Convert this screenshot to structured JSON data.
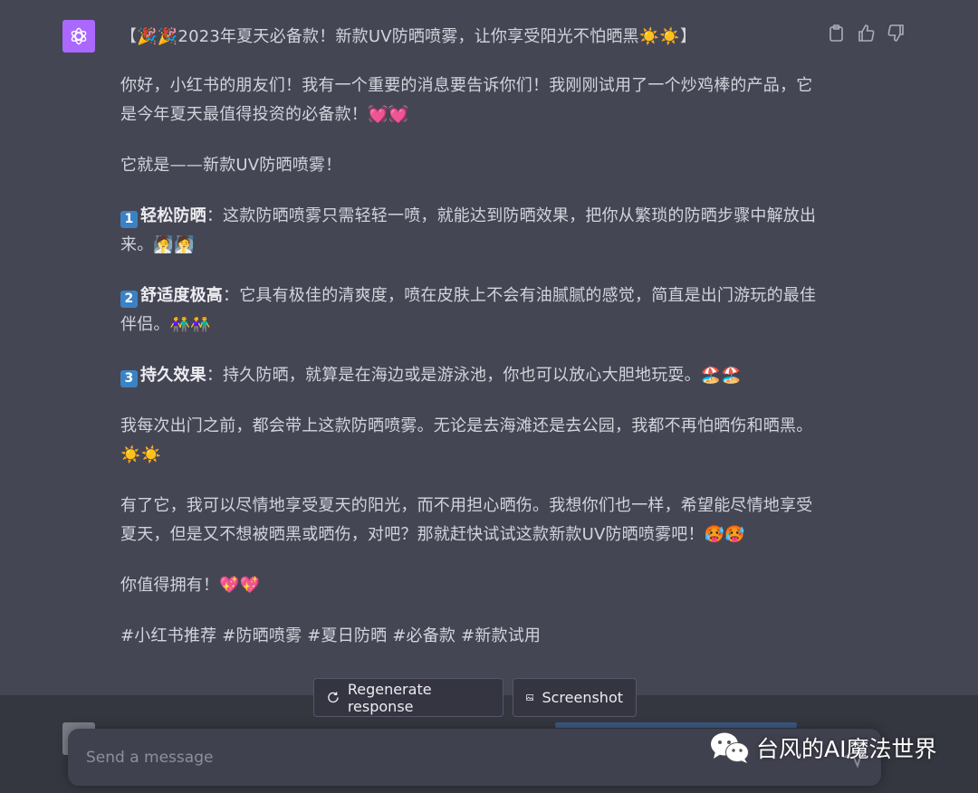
{
  "message": {
    "title": "【🎉🎉2023年夏天必备款！新款UV防晒喷雾，让你享受阳光不怕晒黑☀️☀️】",
    "p1": "你好，小红书的朋友们！我有一个重要的消息要告诉你们！我刚刚试用了一个炒鸡棒的产品，它是今年夏天最值得投资的必备款！💓💓",
    "p2": "它就是——新款UV防晒喷雾！",
    "features": [
      {
        "num": "1",
        "name": "轻松防晒",
        "text": "：这款防晒喷雾只需轻轻一喷，就能达到防晒效果，把你从繁琐的防晒步骤中解放出来。🧖🧖"
      },
      {
        "num": "2",
        "name": "舒适度极高",
        "text": "：它具有极佳的清爽度，喷在皮肤上不会有油腻腻的感觉，简直是出门游玩的最佳伴侣。👫👫"
      },
      {
        "num": "3",
        "name": "持久效果",
        "text": "：持久防晒，就算是在海边或是游泳池，你也可以放心大胆地玩耍。🏖️🏖️"
      }
    ],
    "p3": "我每次出门之前，都会带上这款防晒喷雾。无论是去海滩还是去公园，我都不再怕晒伤和晒黑。☀️☀️",
    "p4": "有了它，我可以尽情地享受夏天的阳光，而不用担心晒伤。我想你们也一样，希望能尽情地享受夏天，但是又不想被晒黑或晒伤，对吧？那就赶快试试这款新款UV防晒喷雾吧！🥵🥵",
    "p5": "你值得拥有！💖💖",
    "tags": "#小红书推荐 #防晒喷雾 #夏日防晒 #必备款 #新款试用"
  },
  "actions": {
    "copy_icon": "clipboard-icon",
    "like_icon": "thumbs-up-icon",
    "dislike_icon": "thumbs-down-icon"
  },
  "buttons": {
    "regenerate": "Regenerate response",
    "screenshot": "Screenshot"
  },
  "composer": {
    "placeholder": "Send a message"
  },
  "watermark": {
    "text": "台风的AI魔法世界"
  },
  "colors": {
    "background": "#444654",
    "avatar": "#ab68ff",
    "text": "#d1d5db",
    "input": "#40414f"
  }
}
